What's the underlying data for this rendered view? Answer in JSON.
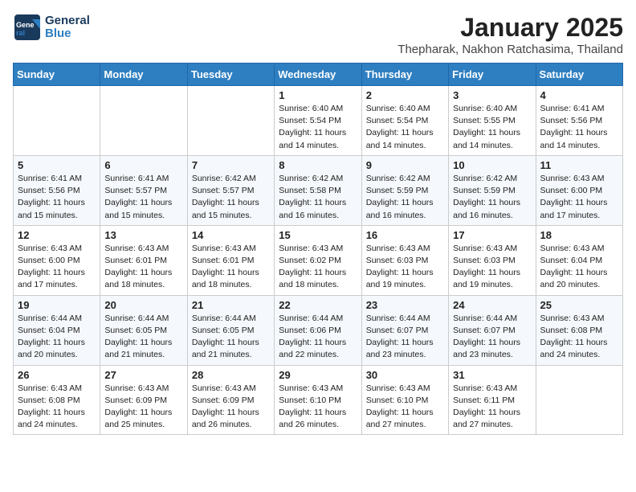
{
  "header": {
    "logo_general": "General",
    "logo_blue": "Blue",
    "month_title": "January 2025",
    "subtitle": "Thepharak, Nakhon Ratchasima, Thailand"
  },
  "weekdays": [
    "Sunday",
    "Monday",
    "Tuesday",
    "Wednesday",
    "Thursday",
    "Friday",
    "Saturday"
  ],
  "weeks": [
    [
      {
        "day": "",
        "info": ""
      },
      {
        "day": "",
        "info": ""
      },
      {
        "day": "",
        "info": ""
      },
      {
        "day": "1",
        "info": "Sunrise: 6:40 AM\nSunset: 5:54 PM\nDaylight: 11 hours\nand 14 minutes."
      },
      {
        "day": "2",
        "info": "Sunrise: 6:40 AM\nSunset: 5:54 PM\nDaylight: 11 hours\nand 14 minutes."
      },
      {
        "day": "3",
        "info": "Sunrise: 6:40 AM\nSunset: 5:55 PM\nDaylight: 11 hours\nand 14 minutes."
      },
      {
        "day": "4",
        "info": "Sunrise: 6:41 AM\nSunset: 5:56 PM\nDaylight: 11 hours\nand 14 minutes."
      }
    ],
    [
      {
        "day": "5",
        "info": "Sunrise: 6:41 AM\nSunset: 5:56 PM\nDaylight: 11 hours\nand 15 minutes."
      },
      {
        "day": "6",
        "info": "Sunrise: 6:41 AM\nSunset: 5:57 PM\nDaylight: 11 hours\nand 15 minutes."
      },
      {
        "day": "7",
        "info": "Sunrise: 6:42 AM\nSunset: 5:57 PM\nDaylight: 11 hours\nand 15 minutes."
      },
      {
        "day": "8",
        "info": "Sunrise: 6:42 AM\nSunset: 5:58 PM\nDaylight: 11 hours\nand 16 minutes."
      },
      {
        "day": "9",
        "info": "Sunrise: 6:42 AM\nSunset: 5:59 PM\nDaylight: 11 hours\nand 16 minutes."
      },
      {
        "day": "10",
        "info": "Sunrise: 6:42 AM\nSunset: 5:59 PM\nDaylight: 11 hours\nand 16 minutes."
      },
      {
        "day": "11",
        "info": "Sunrise: 6:43 AM\nSunset: 6:00 PM\nDaylight: 11 hours\nand 17 minutes."
      }
    ],
    [
      {
        "day": "12",
        "info": "Sunrise: 6:43 AM\nSunset: 6:00 PM\nDaylight: 11 hours\nand 17 minutes."
      },
      {
        "day": "13",
        "info": "Sunrise: 6:43 AM\nSunset: 6:01 PM\nDaylight: 11 hours\nand 18 minutes."
      },
      {
        "day": "14",
        "info": "Sunrise: 6:43 AM\nSunset: 6:01 PM\nDaylight: 11 hours\nand 18 minutes."
      },
      {
        "day": "15",
        "info": "Sunrise: 6:43 AM\nSunset: 6:02 PM\nDaylight: 11 hours\nand 18 minutes."
      },
      {
        "day": "16",
        "info": "Sunrise: 6:43 AM\nSunset: 6:03 PM\nDaylight: 11 hours\nand 19 minutes."
      },
      {
        "day": "17",
        "info": "Sunrise: 6:43 AM\nSunset: 6:03 PM\nDaylight: 11 hours\nand 19 minutes."
      },
      {
        "day": "18",
        "info": "Sunrise: 6:43 AM\nSunset: 6:04 PM\nDaylight: 11 hours\nand 20 minutes."
      }
    ],
    [
      {
        "day": "19",
        "info": "Sunrise: 6:44 AM\nSunset: 6:04 PM\nDaylight: 11 hours\nand 20 minutes."
      },
      {
        "day": "20",
        "info": "Sunrise: 6:44 AM\nSunset: 6:05 PM\nDaylight: 11 hours\nand 21 minutes."
      },
      {
        "day": "21",
        "info": "Sunrise: 6:44 AM\nSunset: 6:05 PM\nDaylight: 11 hours\nand 21 minutes."
      },
      {
        "day": "22",
        "info": "Sunrise: 6:44 AM\nSunset: 6:06 PM\nDaylight: 11 hours\nand 22 minutes."
      },
      {
        "day": "23",
        "info": "Sunrise: 6:44 AM\nSunset: 6:07 PM\nDaylight: 11 hours\nand 23 minutes."
      },
      {
        "day": "24",
        "info": "Sunrise: 6:44 AM\nSunset: 6:07 PM\nDaylight: 11 hours\nand 23 minutes."
      },
      {
        "day": "25",
        "info": "Sunrise: 6:43 AM\nSunset: 6:08 PM\nDaylight: 11 hours\nand 24 minutes."
      }
    ],
    [
      {
        "day": "26",
        "info": "Sunrise: 6:43 AM\nSunset: 6:08 PM\nDaylight: 11 hours\nand 24 minutes."
      },
      {
        "day": "27",
        "info": "Sunrise: 6:43 AM\nSunset: 6:09 PM\nDaylight: 11 hours\nand 25 minutes."
      },
      {
        "day": "28",
        "info": "Sunrise: 6:43 AM\nSunset: 6:09 PM\nDaylight: 11 hours\nand 26 minutes."
      },
      {
        "day": "29",
        "info": "Sunrise: 6:43 AM\nSunset: 6:10 PM\nDaylight: 11 hours\nand 26 minutes."
      },
      {
        "day": "30",
        "info": "Sunrise: 6:43 AM\nSunset: 6:10 PM\nDaylight: 11 hours\nand 27 minutes."
      },
      {
        "day": "31",
        "info": "Sunrise: 6:43 AM\nSunset: 6:11 PM\nDaylight: 11 hours\nand 27 minutes."
      },
      {
        "day": "",
        "info": ""
      }
    ]
  ]
}
